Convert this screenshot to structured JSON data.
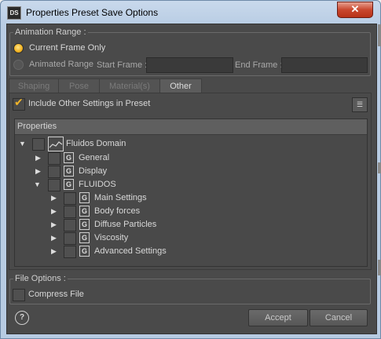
{
  "window": {
    "app_icon_text": "DS",
    "title": "Properties Preset Save Options",
    "close_glyph": "✕"
  },
  "animation_range": {
    "group_title": "Animation Range :",
    "current_frame_label": "Current Frame Only",
    "animated_range_label": "Animated Range",
    "start_frame_label": "Start Frame :",
    "start_frame_value": "",
    "end_frame_label": "End Frame :",
    "end_frame_value": "",
    "selected": "current_frame"
  },
  "tabs": [
    {
      "label": "Shaping",
      "active": false
    },
    {
      "label": "Pose",
      "active": false
    },
    {
      "label": "Material(s)",
      "active": false
    },
    {
      "label": "Other",
      "active": true
    }
  ],
  "other_tab": {
    "include_label": "Include Other Settings in Preset",
    "include_checked": true
  },
  "properties": {
    "header": "Properties",
    "rows": [
      {
        "label": "Fluidos Domain",
        "level": 0,
        "expand": "open",
        "icon": "domain-icon"
      },
      {
        "label": "General",
        "level": 1,
        "expand": "closed",
        "icon": "group-icon"
      },
      {
        "label": "Display",
        "level": 1,
        "expand": "closed",
        "icon": "group-icon"
      },
      {
        "label": "FLUIDOS",
        "level": 1,
        "expand": "open",
        "icon": "group-icon"
      },
      {
        "label": "Main Settings",
        "level": 2,
        "expand": "closed",
        "icon": "group-icon"
      },
      {
        "label": "Body forces",
        "level": 2,
        "expand": "closed",
        "icon": "group-icon"
      },
      {
        "label": "Diffuse Particles",
        "level": 2,
        "expand": "closed",
        "icon": "group-icon"
      },
      {
        "label": "Viscosity",
        "level": 2,
        "expand": "closed",
        "icon": "group-icon"
      },
      {
        "label": "Advanced Settings",
        "level": 2,
        "expand": "closed",
        "icon": "group-icon"
      }
    ]
  },
  "file_options": {
    "group_title": "File Options :",
    "compress_label": "Compress File",
    "compress_checked": false
  },
  "footer": {
    "help_glyph": "?",
    "accept_label": "Accept",
    "cancel_label": "Cancel"
  },
  "colors": {
    "panel": "#4a4a4a",
    "accent": "#f3b526",
    "titlebar": "#c4d6eb",
    "close": "#c9472e"
  }
}
